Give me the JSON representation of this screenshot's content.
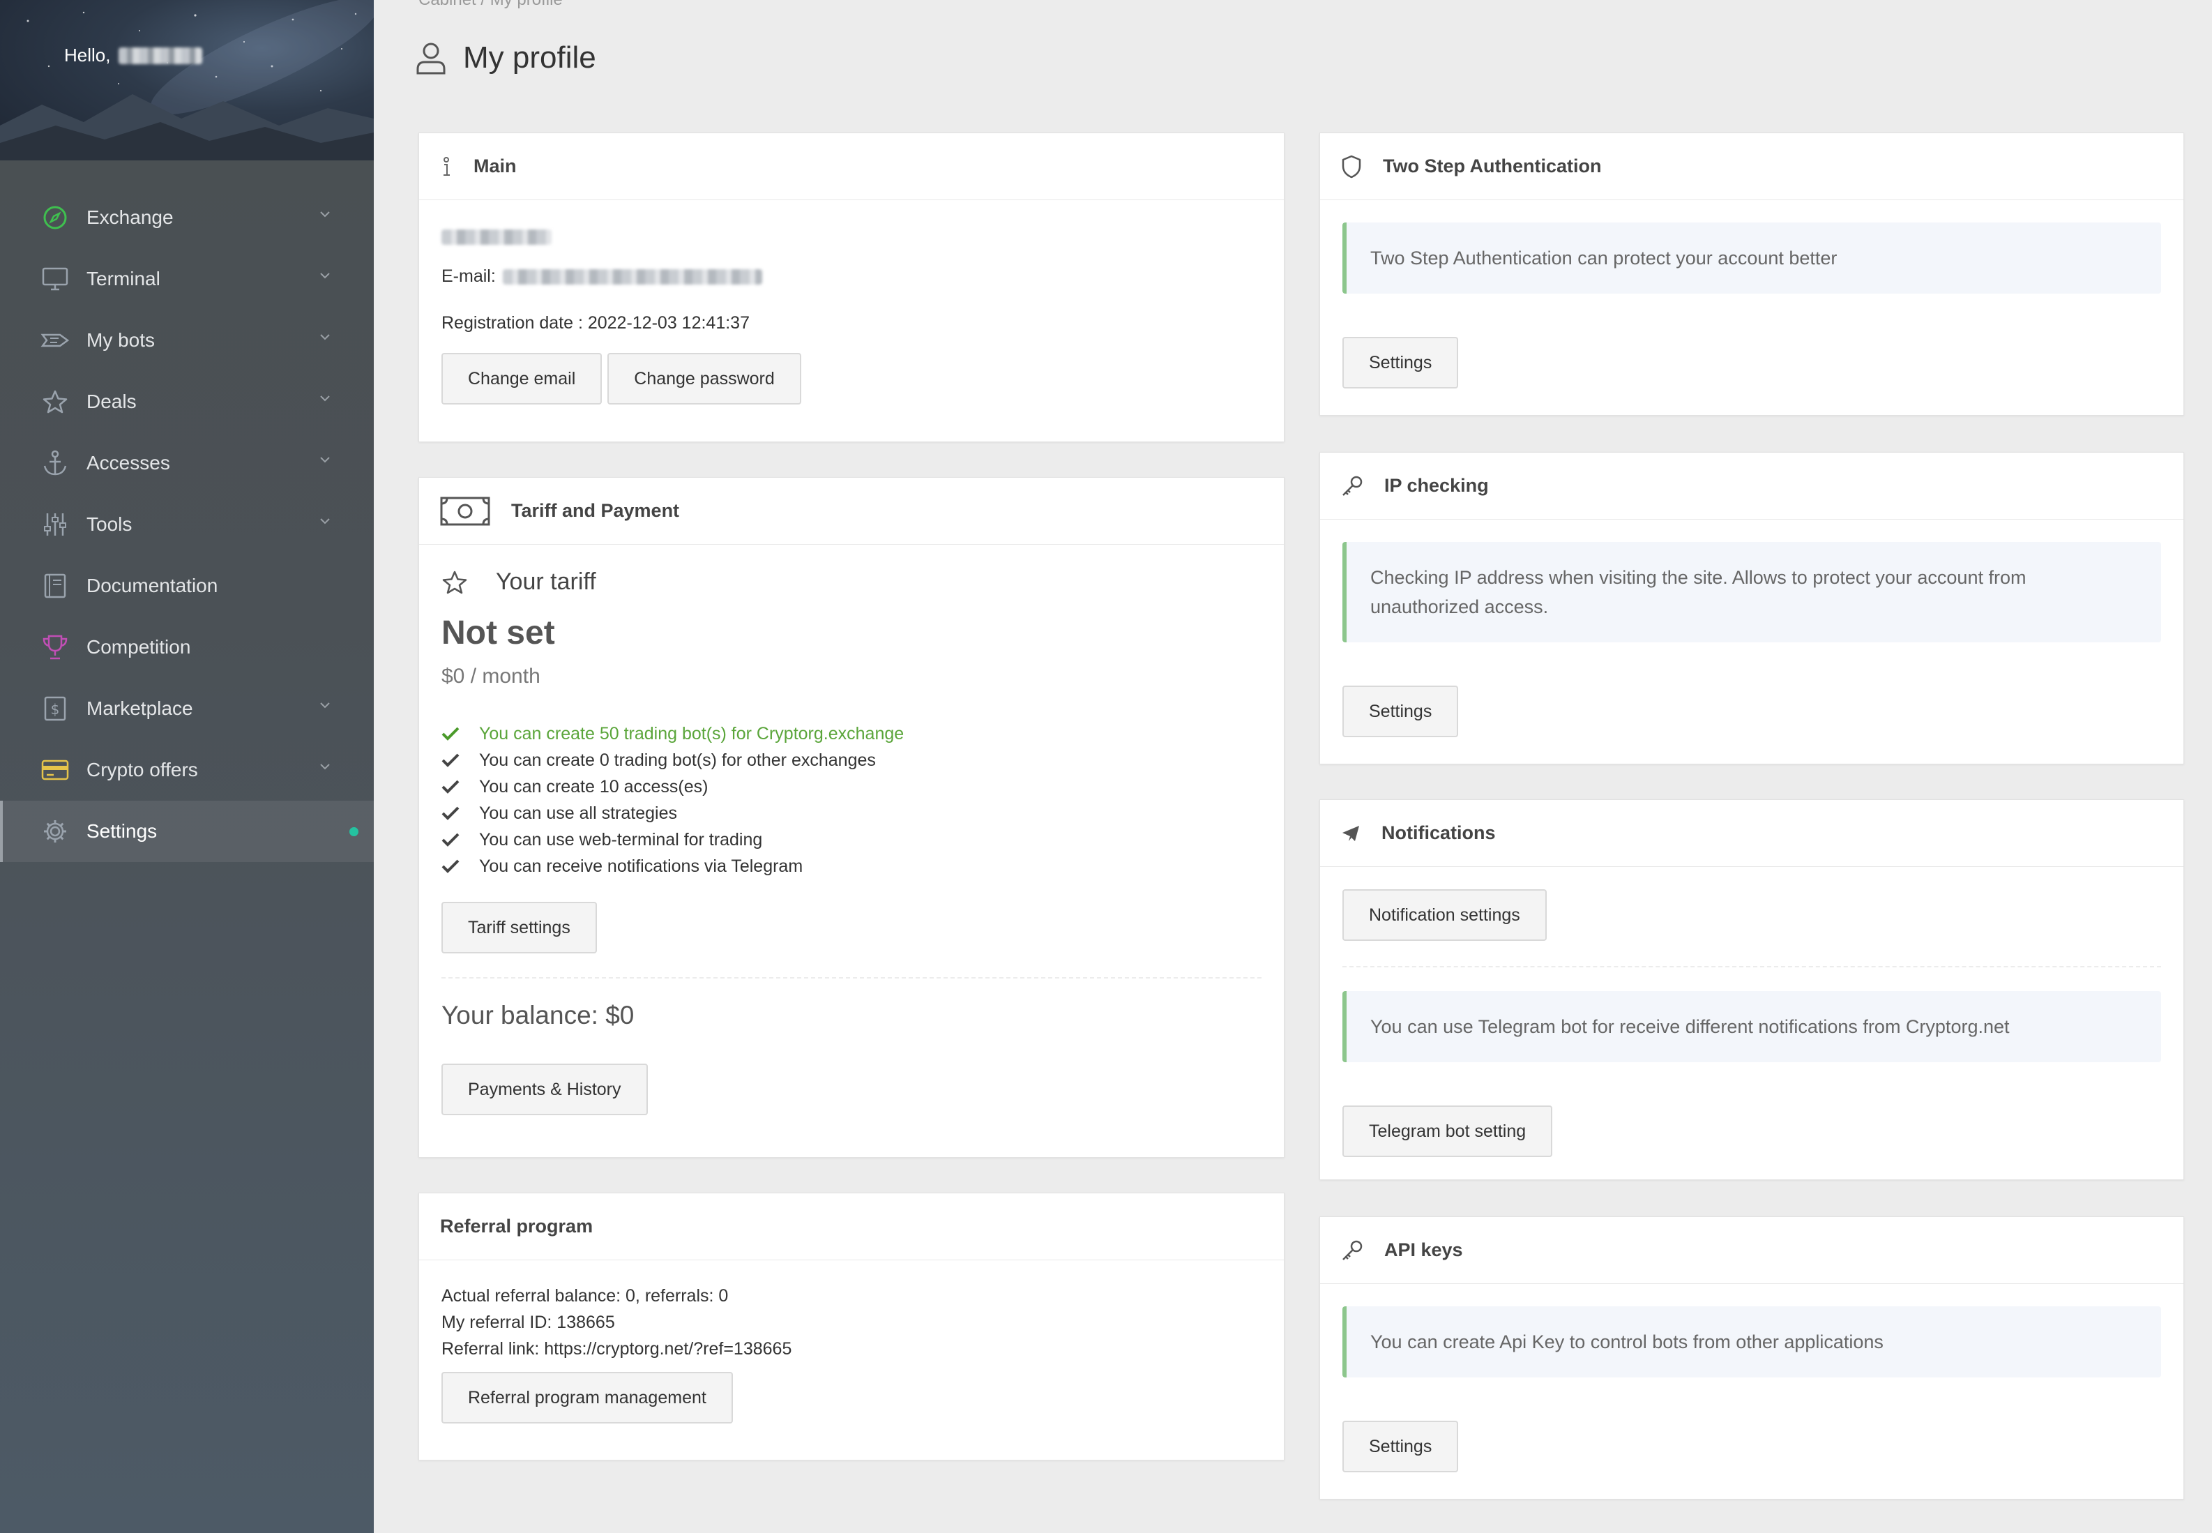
{
  "sidebar": {
    "greeting": "Hello,",
    "items": [
      {
        "label": "Exchange",
        "icon": "compass-icon",
        "has_submenu": true
      },
      {
        "label": "Terminal",
        "icon": "monitor-icon",
        "has_submenu": true
      },
      {
        "label": "My bots",
        "icon": "bot-icon",
        "has_submenu": true
      },
      {
        "label": "Deals",
        "icon": "star-icon",
        "has_submenu": true
      },
      {
        "label": "Accesses",
        "icon": "anchor-icon",
        "has_submenu": true
      },
      {
        "label": "Tools",
        "icon": "sliders-icon",
        "has_submenu": true
      },
      {
        "label": "Documentation",
        "icon": "book-icon",
        "has_submenu": false
      },
      {
        "label": "Competition",
        "icon": "trophy-icon",
        "has_submenu": false
      },
      {
        "label": "Marketplace",
        "icon": "dollar-icon",
        "has_submenu": true
      },
      {
        "label": "Crypto offers",
        "icon": "card-icon",
        "has_submenu": true
      },
      {
        "label": "Settings",
        "icon": "gear-icon",
        "has_submenu": false,
        "active": true
      }
    ],
    "colors": {
      "exchange_icon": "#3fbf4f",
      "competition_icon": "#c14fb5",
      "crypto_offers_icon": "#e5c44a",
      "active_dot": "#25c2a0"
    }
  },
  "breadcrumb": "Cabinet / My profile",
  "page": {
    "title": "My profile"
  },
  "main_card": {
    "title": "Main",
    "email_label": "E-mail:",
    "registration_label": "Registration date : 2022-12-03 12:41:37",
    "change_email": "Change email",
    "change_password": "Change password"
  },
  "tariff_card": {
    "title": "Tariff and Payment",
    "your_tariff": "Your tariff",
    "tariff_name": "Not set",
    "price": "$0 / month",
    "features": [
      "You can create 50 trading bot(s) for Cryptorg.exchange",
      "You can create 0 trading bot(s) for other exchanges",
      "You can create 10 access(es)",
      "You can use all strategies",
      "You can use web-terminal for trading",
      "You can receive notifications via Telegram"
    ],
    "tariff_settings": "Tariff settings",
    "balance": "Your balance: $0",
    "payments_history": "Payments & History",
    "highlight_color": "#5aa53a"
  },
  "referral_card": {
    "title": "Referral program",
    "balance_line": "Actual referral balance: 0, referrals: 0",
    "id_line": "My referral ID: 138665",
    "link_line": "Referral link: https://cryptorg.net/?ref=138665",
    "manage_button": "Referral program management"
  },
  "two_step_card": {
    "title": "Two Step Authentication",
    "info": "Two Step Authentication can protect your account better",
    "settings": "Settings"
  },
  "ip_card": {
    "title": "IP checking",
    "info": "Checking IP address when visiting the site. Allows to protect your account from unauthorized access.",
    "settings": "Settings"
  },
  "notifications_card": {
    "title": "Notifications",
    "notification_settings": "Notification settings",
    "info": "You can use Telegram bot for receive different notifications from Cryptorg.net",
    "telegram_setting": "Telegram bot setting"
  },
  "api_card": {
    "title": "API keys",
    "info": "You can create Api Key to control bots from other applications",
    "settings": "Settings"
  }
}
